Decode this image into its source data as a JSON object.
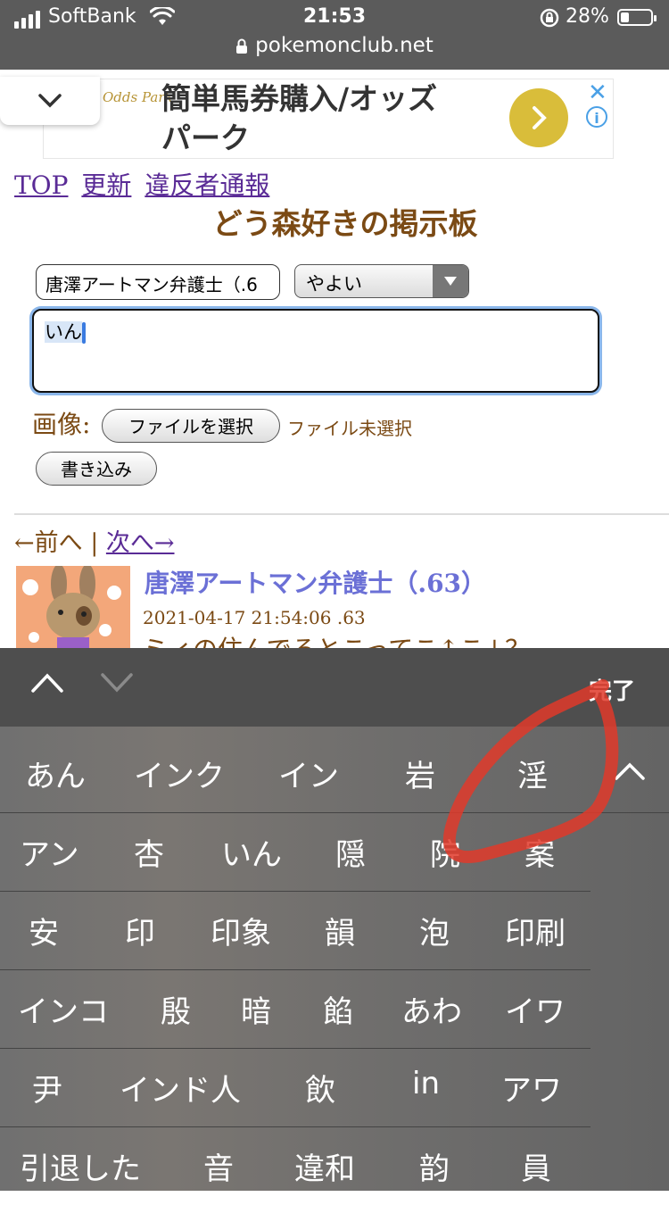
{
  "status_bar": {
    "carrier": "SoftBank",
    "time": "21:53",
    "battery_percent": "28%",
    "battery_level": 0.28
  },
  "browser": {
    "url": "pokemonclub.net"
  },
  "ad": {
    "brand": "Odds Park",
    "line1": "簡単馬券購入/オッズ",
    "line2": "パーク"
  },
  "nav": {
    "links": [
      "TOP",
      "更新",
      "違反者通報"
    ]
  },
  "board": {
    "title": "どう森好きの掲示板"
  },
  "form": {
    "name_value": "唐澤アートマン弁護士（.6",
    "mail_select": "やよい",
    "message_value": "いん",
    "image_label": "画像:",
    "file_button": "ファイルを選択",
    "file_status": "ファイル未選択",
    "submit_button": "書き込み"
  },
  "pager": {
    "prev": "←前へ",
    "separator": " | ",
    "next": "次へ→"
  },
  "post": {
    "author": "唐澤アートマン弁護士（.63）",
    "date": "2021-04-17 21:54:06 .63",
    "body": "ミィの住んでるとこってこ↑こ↓？"
  },
  "keyboard_toolbar": {
    "done_label": "完了"
  },
  "candidates": [
    [
      "あん",
      "インク",
      "イン",
      "岩",
      "淫"
    ],
    [
      "アン",
      "杏",
      "いん",
      "隠",
      "院",
      "案"
    ],
    [
      "安",
      "印",
      "印象",
      "韻",
      "泡",
      "印刷"
    ],
    [
      "インコ",
      "殷",
      "暗",
      "餡",
      "あわ",
      "イワ"
    ],
    [
      "尹",
      "インド人",
      "飲",
      "in",
      "アワ"
    ],
    [
      "引退した",
      "音",
      "違和",
      "韵",
      "員"
    ]
  ],
  "annotation_color": "#e03a2a"
}
